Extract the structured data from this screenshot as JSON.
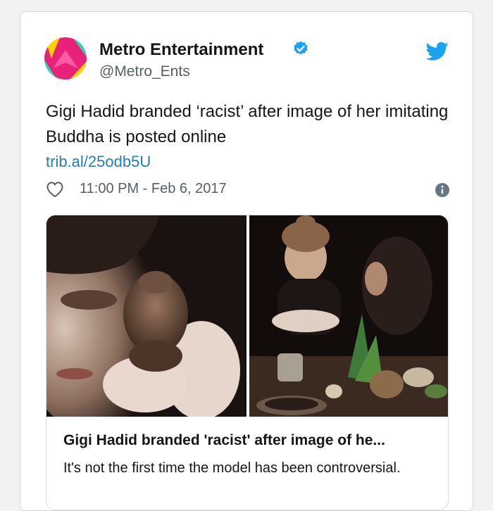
{
  "account": {
    "display_name": "Metro Entertainment",
    "handle": "@Metro_Ents",
    "verified": true,
    "avatar_colors": [
      "#e8217a",
      "#2fd4b0",
      "#ffd200"
    ]
  },
  "tweet": {
    "text": "Gigi Hadid branded ‘racist’ after image of her imitating Buddha is posted online",
    "link": "trib.al/25odb5U",
    "timestamp": "11:00 PM - Feb 6, 2017"
  },
  "card": {
    "title": "Gigi Hadid branded 'racist' after image of he...",
    "description": "It's not the first time the model has been controversial."
  },
  "icons": {
    "verified": "verified-badge-icon",
    "brand": "twitter-bird-icon",
    "like": "heart-icon",
    "info": "info-icon"
  },
  "colors": {
    "link": "#2b7bb9",
    "twitter_blue": "#1da1f2",
    "text_primary": "#14171a",
    "text_secondary": "#555f66"
  }
}
